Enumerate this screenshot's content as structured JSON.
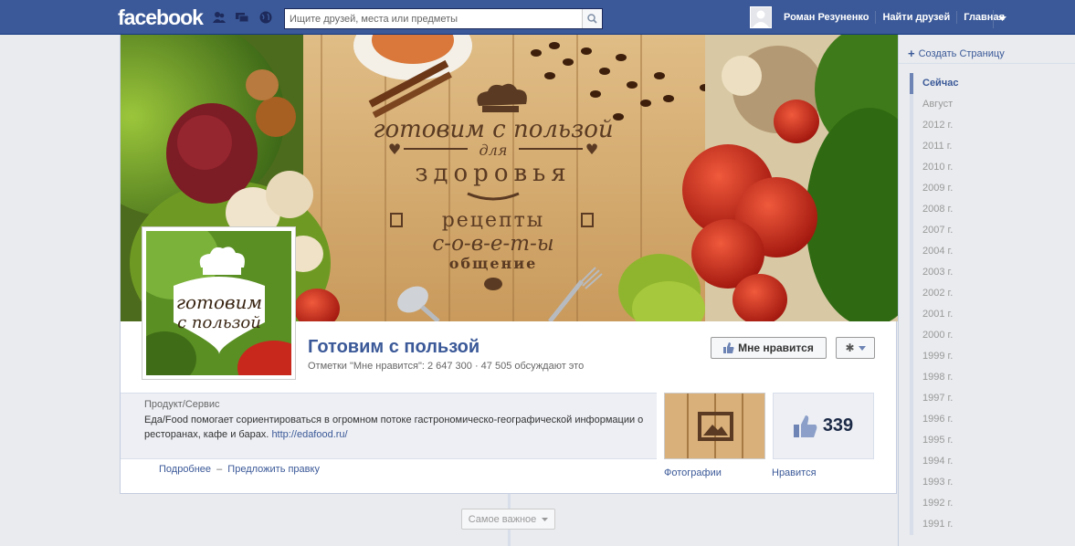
{
  "topbar": {
    "logo": "facebook",
    "search_placeholder": "Ищите друзей, места или предметы",
    "user_name": "Роман Резуненко",
    "find_friends": "Найти друзей",
    "home": "Главная"
  },
  "page": {
    "name": "Готовим с пользой",
    "stats": "Отметки \"Мне нравится\": 2 647 300 · 47 505 обсуждают это",
    "like_button": "Мне нравится",
    "category": "Продукт/Сервис",
    "description": "Еда/Food помогает сориентироваться в огромном потоке гастрономическо-географической информации о ресторанах, кафе и барах.",
    "url": "http://edafood.ru/",
    "more_link": "Подробнее",
    "separator": "–",
    "suggest_link": "Предложить правку",
    "photos_label": "Фотографии",
    "likes_count": "339",
    "likes_label": "Нравится",
    "highlights": "Самое важное"
  },
  "cover": {
    "line1": "готовим с пользой",
    "line2": "для",
    "line3": "здоровья",
    "line4": "рецепты",
    "line5": "с-о-в-е-т-ы",
    "line6": "общение"
  },
  "profile_logo": {
    "line1": "готовим",
    "line2": "с пользой"
  },
  "right_col": {
    "create_page": "Создать Страницу",
    "years": [
      "Сейчас",
      "Август",
      "2012 г.",
      "2011 г.",
      "2010 г.",
      "2009 г.",
      "2008 г.",
      "2007 г.",
      "2004 г.",
      "2003 г.",
      "2002 г.",
      "2001 г.",
      "2000 г.",
      "1999 г.",
      "1998 г.",
      "1997 г.",
      "1996 г.",
      "1995 г.",
      "1994 г.",
      "1993 г.",
      "1992 г.",
      "1991 г."
    ]
  },
  "colors": {
    "brand": "#3b5998",
    "wood": "#d4a96a",
    "ink": "#5a3a22",
    "tomato": "#c8271c"
  }
}
